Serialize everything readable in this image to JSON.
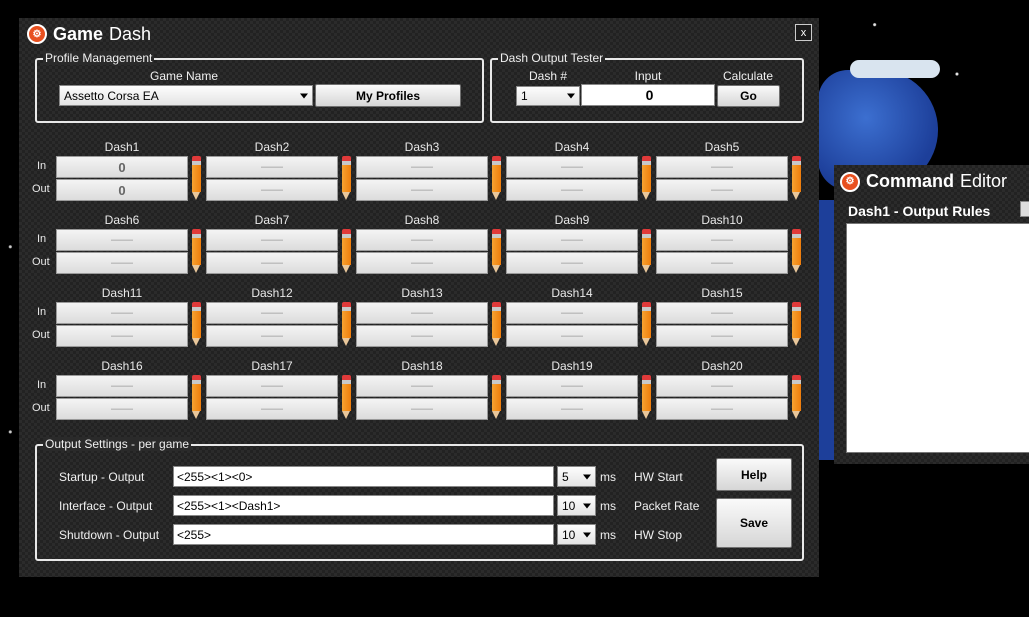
{
  "window": {
    "title_bold": "Game",
    "title_rest": "Dash",
    "close_label": "x",
    "icon": "gamedash-logo-icon"
  },
  "profile": {
    "legend": "Profile Management",
    "game_name_label": "Game Name",
    "game_selected": "Assetto Corsa EA",
    "my_profiles_label": "My Profiles"
  },
  "tester": {
    "legend": "Dash Output Tester",
    "dash_num_label": "Dash #",
    "input_label": "Input",
    "calculate_label": "Calculate",
    "dash_selected": "1",
    "input_value": "0",
    "go_label": "Go"
  },
  "dash_grid": {
    "in_label": "In",
    "out_label": "Out",
    "edit_icon": "pencil-icon",
    "dashes": [
      {
        "name": "Dash1",
        "in": "0",
        "out": "0"
      },
      {
        "name": "Dash2",
        "in": "——",
        "out": "——"
      },
      {
        "name": "Dash3",
        "in": "——",
        "out": "——"
      },
      {
        "name": "Dash4",
        "in": "——",
        "out": "——"
      },
      {
        "name": "Dash5",
        "in": "——",
        "out": "——"
      },
      {
        "name": "Dash6",
        "in": "——",
        "out": "——"
      },
      {
        "name": "Dash7",
        "in": "——",
        "out": "——"
      },
      {
        "name": "Dash8",
        "in": "——",
        "out": "——"
      },
      {
        "name": "Dash9",
        "in": "——",
        "out": "——"
      },
      {
        "name": "Dash10",
        "in": "——",
        "out": "——"
      },
      {
        "name": "Dash11",
        "in": "——",
        "out": "——"
      },
      {
        "name": "Dash12",
        "in": "——",
        "out": "——"
      },
      {
        "name": "Dash13",
        "in": "——",
        "out": "——"
      },
      {
        "name": "Dash14",
        "in": "——",
        "out": "——"
      },
      {
        "name": "Dash15",
        "in": "——",
        "out": "——"
      },
      {
        "name": "Dash16",
        "in": "——",
        "out": "——"
      },
      {
        "name": "Dash17",
        "in": "——",
        "out": "——"
      },
      {
        "name": "Dash18",
        "in": "——",
        "out": "——"
      },
      {
        "name": "Dash19",
        "in": "——",
        "out": "——"
      },
      {
        "name": "Dash20",
        "in": "——",
        "out": "——"
      }
    ]
  },
  "output": {
    "legend": "Output Settings - per game",
    "ms_label": "ms",
    "rows": [
      {
        "label": "Startup - Output",
        "value": "<255><1><0>",
        "ms": "5",
        "right_label": "HW Start"
      },
      {
        "label": "Interface - Output",
        "value": "<255><1><Dash1>",
        "ms": "10",
        "right_label": "Packet Rate"
      },
      {
        "label": "Shutdown - Output",
        "value": "<255>",
        "ms": "10",
        "right_label": "HW Stop"
      }
    ],
    "help_label": "Help",
    "save_label": "Save"
  },
  "command_editor": {
    "title_bold": "Command",
    "title_rest": "Editor",
    "subtitle": "Dash1 - Output Rules"
  }
}
